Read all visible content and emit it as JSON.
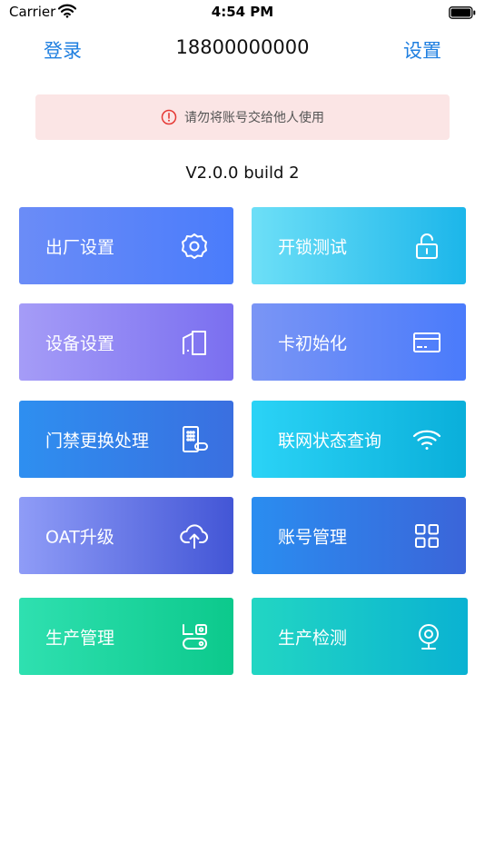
{
  "status_bar": {
    "carrier": "Carrier",
    "time": "4:54 PM"
  },
  "nav": {
    "left_label": "登录",
    "title": "18800000000",
    "right_label": "设置"
  },
  "warning": {
    "text": "请勿将账号交给他人使用",
    "icon": "alert-circle-icon",
    "color": "#e53935"
  },
  "version": "V2.0.0 build 2",
  "tiles": [
    {
      "label": "出厂设置",
      "icon": "gear-icon"
    },
    {
      "label": "开锁测试",
      "icon": "unlock-icon"
    },
    {
      "label": "设备设置",
      "icon": "device-panel-icon"
    },
    {
      "label": "卡初始化",
      "icon": "card-icon"
    },
    {
      "label": "门禁更换处理",
      "icon": "door-keypad-icon"
    },
    {
      "label": "联网状态查询",
      "icon": "wifi-icon"
    },
    {
      "label": "OAT升级",
      "icon": "upload-cloud-icon"
    },
    {
      "label": "账号管理",
      "icon": "grid-icon"
    },
    {
      "label": "生产管理",
      "icon": "production-icon"
    },
    {
      "label": "生产检测",
      "icon": "camera-icon"
    }
  ],
  "colors": {
    "nav_link": "#1f7fe0",
    "warning_bg": "#fbe5e5"
  }
}
